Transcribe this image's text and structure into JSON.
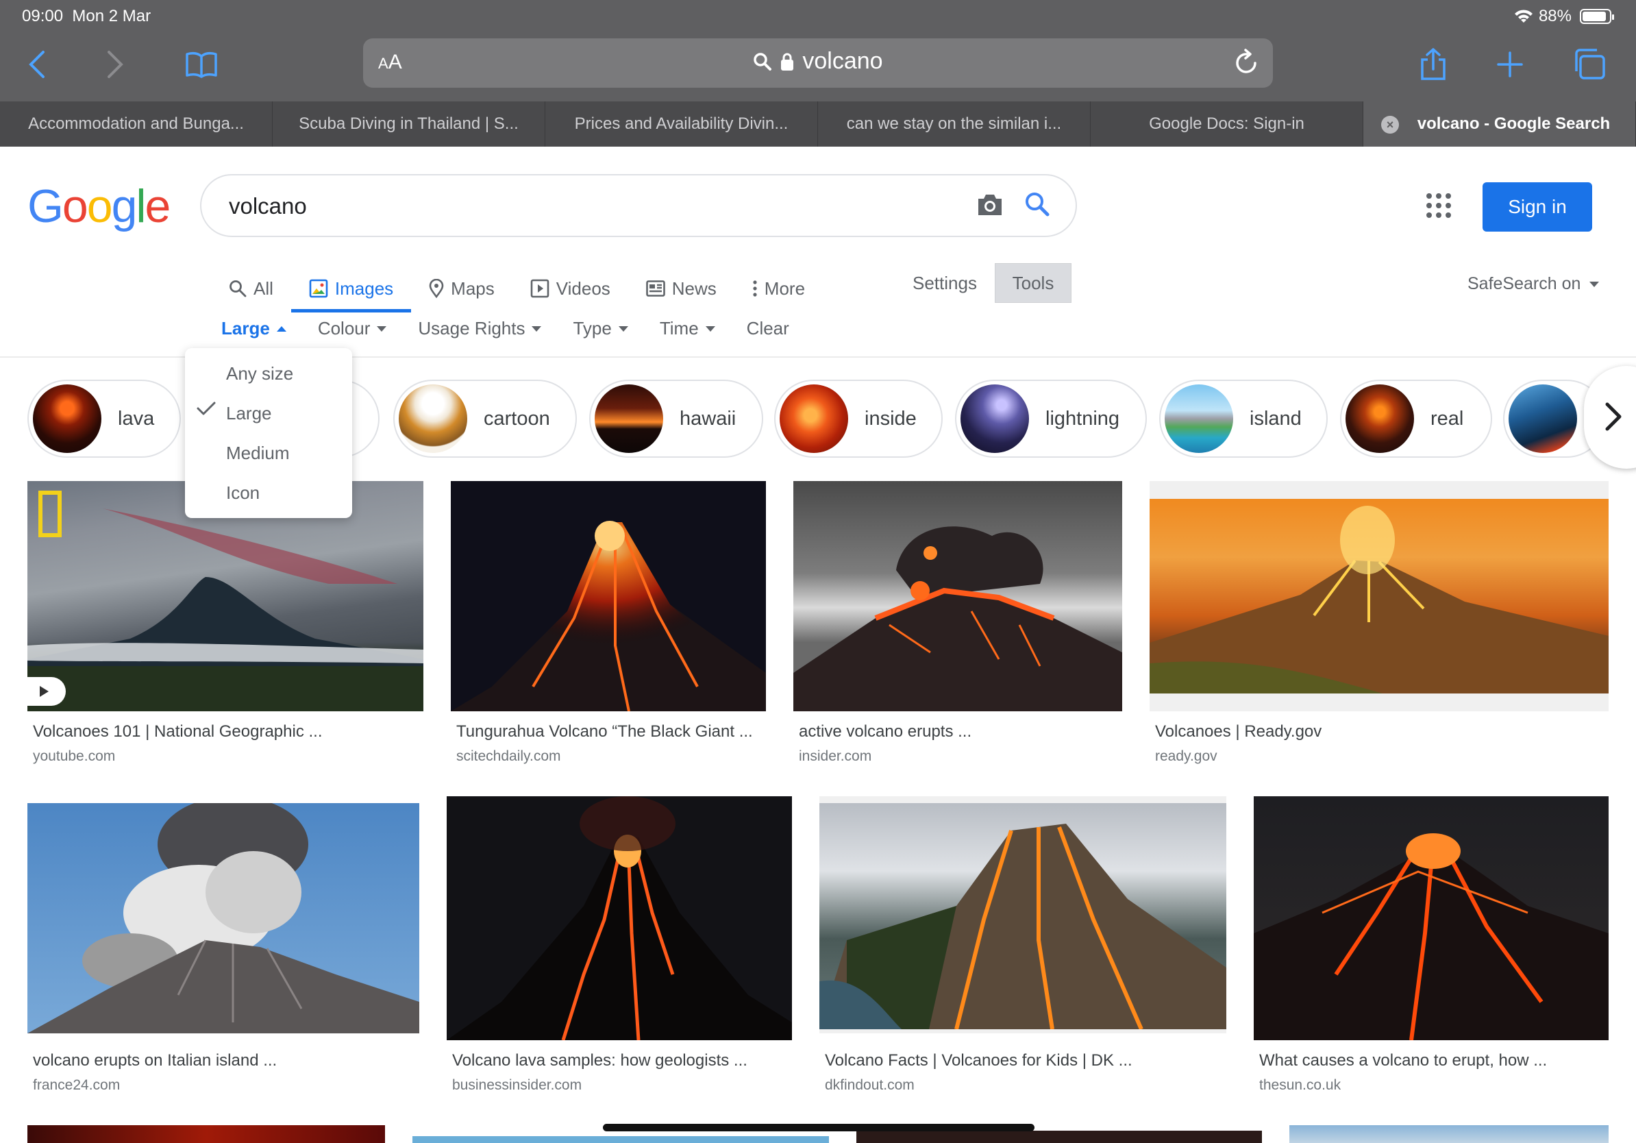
{
  "status_bar": {
    "time": "09:00",
    "date": "Mon 2 Mar",
    "battery": "88%"
  },
  "browser": {
    "url_aa_small": "A",
    "url_aa_big": "A",
    "url_text": "volcano",
    "tabs": [
      {
        "label": "Accommodation and Bunga..."
      },
      {
        "label": "Scuba Diving in Thailand | S..."
      },
      {
        "label": "Prices and Availability Divin..."
      },
      {
        "label": "can we stay on the similan i..."
      },
      {
        "label": "Google Docs: Sign-in"
      },
      {
        "label": "volcano - Google Search"
      }
    ]
  },
  "google": {
    "logo": [
      "G",
      "o",
      "o",
      "g",
      "l",
      "e"
    ],
    "logo_colors": [
      "#4285F4",
      "#EA4335",
      "#FBBC05",
      "#4285F4",
      "#34A853",
      "#EA4335"
    ],
    "query": "volcano",
    "sign_in": "Sign in",
    "nav": {
      "all": "All",
      "images": "Images",
      "maps": "Maps",
      "videos": "Videos",
      "news": "News",
      "more": "More"
    },
    "settings": "Settings",
    "tools": "Tools",
    "safesearch": "SafeSearch on",
    "filters": {
      "size": "Large",
      "colour": "Colour",
      "rights": "Usage Rights",
      "type": "Type",
      "time": "Time",
      "clear": "Clear"
    },
    "size_menu": [
      "Any size",
      "Large",
      "Medium",
      "Icon"
    ],
    "size_selected": "Large",
    "chips": [
      "lava",
      "cartoon",
      "hawaii",
      "inside",
      "lightning",
      "island",
      "real"
    ],
    "results": [
      {
        "title": "Volcanoes 101 | National Geographic ...",
        "source": "youtube.com"
      },
      {
        "title": "Tungurahua Volcano “The Black Giant ...",
        "source": "scitechdaily.com"
      },
      {
        "title": "active volcano erupts ...",
        "source": "insider.com"
      },
      {
        "title": "Volcanoes | Ready.gov",
        "source": "ready.gov"
      },
      {
        "title": "volcano erupts on Italian island ...",
        "source": "france24.com"
      },
      {
        "title": "Volcano lava samples: how geologists ...",
        "source": "businessinsider.com"
      },
      {
        "title": "Volcano Facts | Volcanoes for Kids | DK ...",
        "source": "dkfindout.com"
      },
      {
        "title": "What causes a volcano to erupt, how ...",
        "source": "thesun.co.uk"
      }
    ]
  }
}
